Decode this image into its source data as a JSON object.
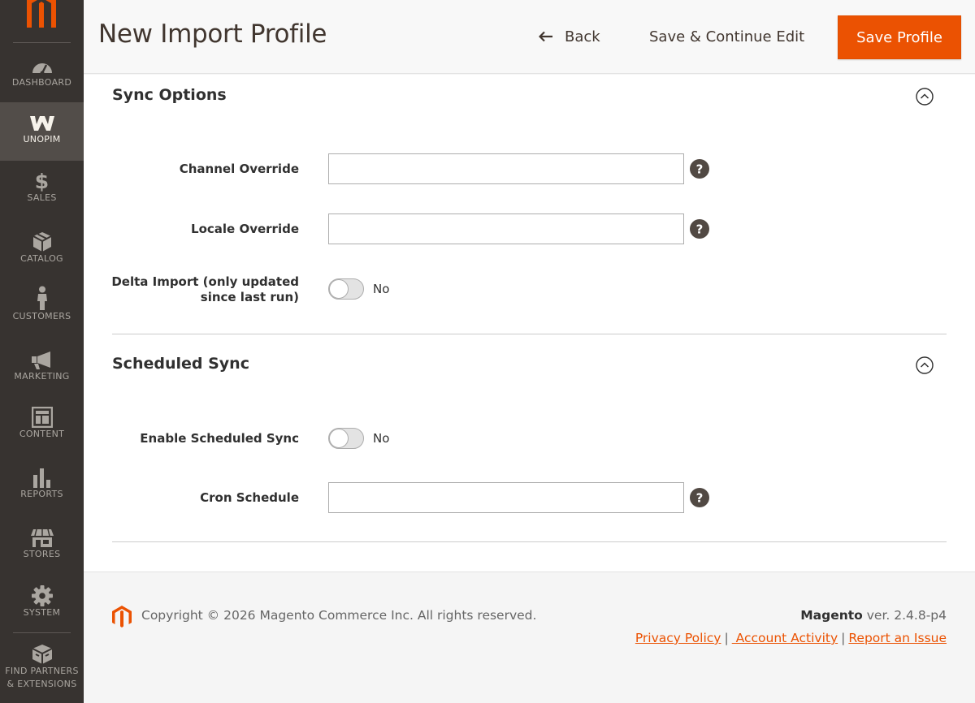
{
  "sidebar": {
    "items": [
      {
        "label": "DASHBOARD",
        "icon": "dashboard-icon"
      },
      {
        "label": "UNOPIM",
        "icon": "unopim-icon"
      },
      {
        "label": "SALES",
        "icon": "dollar-icon"
      },
      {
        "label": "CATALOG",
        "icon": "cube-icon"
      },
      {
        "label": "CUSTOMERS",
        "icon": "person-icon"
      },
      {
        "label": "MARKETING",
        "icon": "megaphone-icon"
      },
      {
        "label": "CONTENT",
        "icon": "layout-icon"
      },
      {
        "label": "REPORTS",
        "icon": "bar-chart-icon"
      },
      {
        "label": "STORES",
        "icon": "storefront-icon"
      },
      {
        "label": "SYSTEM",
        "icon": "gear-icon"
      }
    ],
    "partners_line1": "FIND PARTNERS",
    "partners_line2": "& EXTENSIONS",
    "active_index": 1
  },
  "header": {
    "title": "New Import Profile",
    "back_label": "Back",
    "save_continue_label": "Save & Continue Edit",
    "save_label": "Save Profile"
  },
  "sections": {
    "sync_options": {
      "title": "Sync Options",
      "channel_override": {
        "label": "Channel Override",
        "value": ""
      },
      "locale_override": {
        "label": "Locale Override",
        "value": ""
      },
      "delta_import": {
        "label_line1": "Delta Import (only updated",
        "label_line2": "since last run)",
        "state": "No"
      }
    },
    "scheduled_sync": {
      "title": "Scheduled Sync",
      "enable": {
        "label": "Enable Scheduled Sync",
        "state": "No"
      },
      "cron": {
        "label": "Cron Schedule",
        "value": ""
      }
    }
  },
  "footer": {
    "copyright": "Copyright © 2026 Magento Commerce Inc. All rights reserved.",
    "brand": "Magento",
    "version": " ver. 2.4.8-p4",
    "links": [
      "Privacy Policy",
      " Account Activity",
      "Report an Issue"
    ],
    "separator": "|"
  },
  "colors": {
    "accent": "#eb5202",
    "sidebar_bg": "#373330",
    "sidebar_active": "#524d49"
  }
}
